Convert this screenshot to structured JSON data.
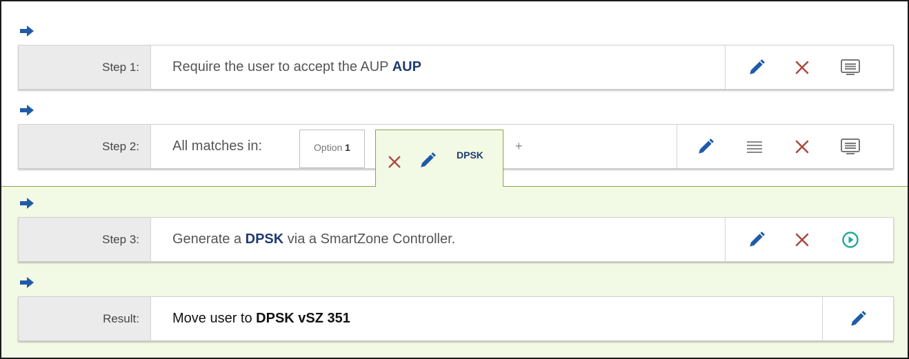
{
  "steps": [
    {
      "label": "Step 1:",
      "text_before": "Require the user to accept the AUP ",
      "text_bold": "AUP",
      "text_after": "",
      "actions": [
        "edit-icon",
        "delete-icon",
        "display-icon"
      ]
    },
    {
      "label": "Step 2:",
      "text_before": "All matches in:",
      "options": {
        "option_prefix": "Option ",
        "option_number": "1",
        "active_tab_label": "DPSK",
        "add_label": "+"
      },
      "actions": [
        "edit-icon",
        "reorder-icon",
        "delete-icon",
        "display-icon"
      ]
    },
    {
      "label": "Step 3:",
      "text_before": "Generate a ",
      "text_bold": "DPSK",
      "text_after": " via a SmartZone Controller.",
      "actions": [
        "edit-icon",
        "delete-icon",
        "run-icon"
      ]
    }
  ],
  "result": {
    "label": "Result:",
    "text_before": "Move user to ",
    "text_bold": "DPSK vSZ 351",
    "actions": [
      "edit-icon"
    ]
  },
  "colors": {
    "edit": "#1f5ba8",
    "delete": "#a84a42",
    "run": "#1aa89a",
    "arrow": "#1f5ba8",
    "display": "#777777",
    "active_zone": "#f2f9e4"
  }
}
